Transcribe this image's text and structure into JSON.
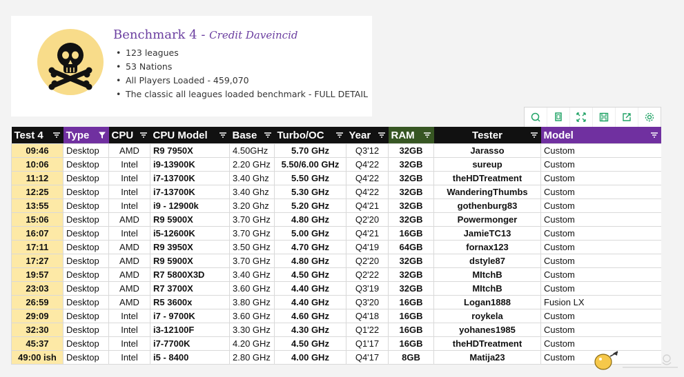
{
  "card": {
    "title": "Benchmark 4 - ",
    "credit": "Credit Daveincid",
    "bullets": [
      "123 leagues",
      "53 Nations",
      "All Players Loaded - 459,070",
      "The classic all leagues loaded benchmark - FULL DETAIL"
    ],
    "icon": "skull-and-crossbones-icon",
    "icon_bg": "#f8dc8a"
  },
  "toolbar": {
    "icons": [
      "search-icon",
      "copy-icon",
      "expand-icon",
      "save-icon",
      "share-icon",
      "settings-icon"
    ],
    "accent": "#21a366"
  },
  "table": {
    "headers": [
      "Test 4",
      "Type",
      "CPU",
      "CPU Model",
      "Base",
      "Turbo/OC",
      "Year",
      "RAM",
      "Tester",
      "Model"
    ],
    "header_colors": {
      "black": "#111111",
      "purple": "#7030a0",
      "green": "#375623"
    },
    "rows": [
      [
        "09:46",
        "Desktop",
        "AMD",
        "R9 7950X",
        "4.50GHz",
        "5.70 GHz",
        "Q3'12",
        "32GB",
        "Jarasso",
        "Custom"
      ],
      [
        "10:06",
        "Desktop",
        "Intel",
        "i9-13900K",
        "2.20 GHz",
        "5.50/6.00 GHz",
        "Q4'22",
        "32GB",
        "sureup",
        "Custom"
      ],
      [
        "11:12",
        "Desktop",
        "Intel",
        "i7-13700K",
        "3.40 Ghz",
        "5.50 GHz",
        "Q4'22",
        "32GB",
        "theHDTreatment",
        "Custom"
      ],
      [
        "12:25",
        "Desktop",
        "Intel",
        "i7-13700K",
        "3.40 Ghz",
        "5.30 GHz",
        "Q4'22",
        "32GB",
        "WanderingThumbs",
        "Custom"
      ],
      [
        "13:55",
        "Desktop",
        "Intel",
        "i9 - 12900k",
        "3.20 Ghz",
        "5.20 GHz",
        "Q4'21",
        "32GB",
        "gothenburg83",
        "Custom"
      ],
      [
        "15:06",
        "Desktop",
        "AMD",
        "R9 5900X",
        "3.70 GHz",
        "4.80 GHz",
        "Q2'20",
        "32GB",
        "Powermonger",
        "Custom"
      ],
      [
        "16:07",
        "Desktop",
        "Intel",
        "i5-12600K",
        "3.70 GHz",
        "5.00 GHz",
        "Q4'21",
        "16GB",
        "JamieTC13",
        "Custom"
      ],
      [
        "17:11",
        "Desktop",
        "AMD",
        "R9 3950X",
        "3.50 GHz",
        "4.70 GHz",
        "Q4'19",
        "64GB",
        "fornax123",
        "Custom"
      ],
      [
        "17:27",
        "Desktop",
        "AMD",
        "R9 5900X",
        "3.70 GHz",
        "4.80 GHz",
        "Q2'20",
        "32GB",
        "dstyle87",
        "Custom"
      ],
      [
        "19:57",
        "Desktop",
        "AMD",
        "R7 5800X3D",
        "3.40 GHz",
        "4.50 GHz",
        "Q2'22",
        "32GB",
        "MItchB",
        "Custom"
      ],
      [
        "23:03",
        "Desktop",
        "AMD",
        "R7 3700X",
        "3.60 GHz",
        "4.40 GHz",
        "Q3'19",
        "32GB",
        "MItchB",
        "Custom"
      ],
      [
        "26:59",
        "Desktop",
        "AMD",
        "R5 3600x",
        "3.80 GHz",
        "4.40 GHz",
        "Q3'20",
        "16GB",
        "Logan1888",
        "Fusion LX"
      ],
      [
        "29:09",
        "Desktop",
        "Intel",
        "i7 - 9700K",
        "3.60 GHz",
        "4.60 GHz",
        "Q4'18",
        "16GB",
        "roykela",
        "Custom"
      ],
      [
        "32:30",
        "Desktop",
        "Intel",
        "i3-12100F",
        "3.30 GHz",
        "4.30 GHz",
        "Q1'22",
        "16GB",
        "yohanes1985",
        "Custom"
      ],
      [
        "45:37",
        "Desktop",
        "Intel",
        "i7-7700K",
        "4.20 GHz",
        "4.50 GHz",
        "Q1'17",
        "16GB",
        "theHDTreatment",
        "Custom"
      ],
      [
        "49:00 ish",
        "Desktop",
        "Intel",
        "i5 - 8400",
        "2.80 GHz",
        "4.00 GHz",
        "Q4'17",
        "8GB",
        "Matija23",
        "Custom"
      ]
    ]
  }
}
